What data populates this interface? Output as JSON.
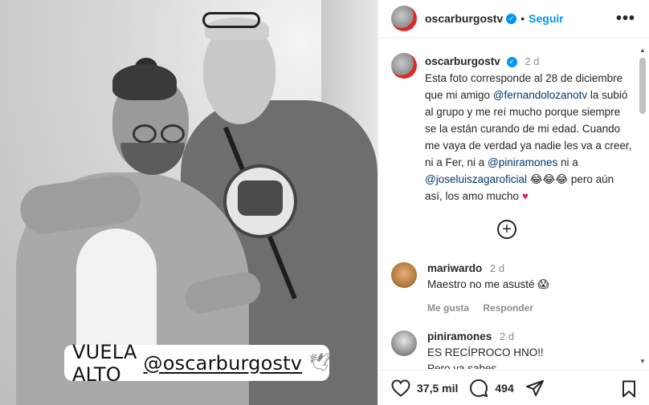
{
  "photo": {
    "sticker_lead": "VUELA ALTO",
    "sticker_handle": "@oscarburgostv",
    "sticker_emoji": "🕊"
  },
  "header": {
    "username": "oscarburgostv",
    "follow_label": "Seguir",
    "more_label": "•••"
  },
  "caption": {
    "username": "oscarburgostv",
    "time": "2 d",
    "part1": "Esta foto corresponde al 28 de diciembre que mi amigo ",
    "mention1": "@fernandolozanotv",
    "part2": " la subió al grupo y me  reí  mucho porque siempre se la están curando de mi edad. Cuando me vaya de verdad ya nadie les va a creer, ni a Fer, ni a ",
    "mention2": "@piniramones",
    "part3": " ni a ",
    "mention3": "@joseluiszagaroficial",
    "part4": " 😂😂😂 pero aún así, los amo mucho ",
    "heart": "♥"
  },
  "load_more_label": "+",
  "comments": [
    {
      "username": "mariwardo",
      "time": "2 d",
      "text": "Maestro no me asusté 😱",
      "like_label": "Me gusta",
      "reply_label": "Responder"
    },
    {
      "username": "piniramones",
      "time": "2 d",
      "text_line1": "ES RECÍPROCO HNO!!",
      "text_line2": "Pero ya sabes"
    }
  ],
  "actions": {
    "likes": "37,5 mil",
    "comments": "494"
  },
  "colors": {
    "accent": "#0095f6",
    "mention": "#00376b",
    "heart": "#e0245e"
  }
}
